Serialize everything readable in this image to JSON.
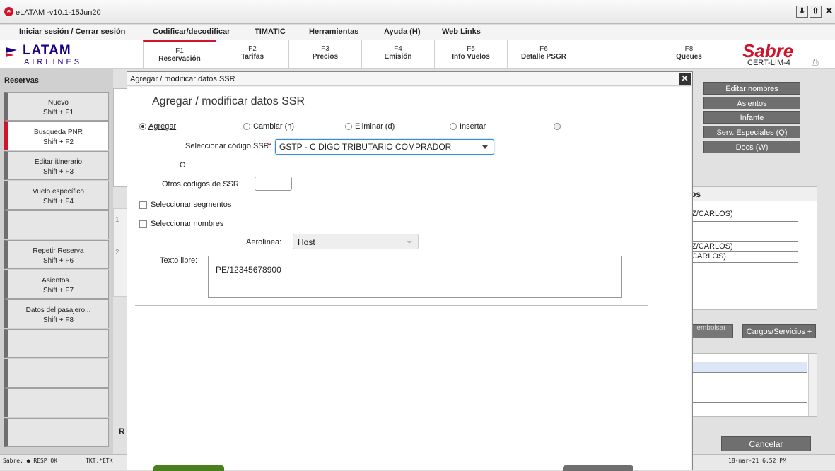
{
  "window": {
    "title": "eLATAM -v10.1-15Jun20",
    "buttons": [
      "⇩",
      "⇧",
      "✕"
    ]
  },
  "menu": [
    "Iniciar sesión / Cerrar sesión",
    "Codificar/decodificar",
    "TIMATIC",
    "Herramientas",
    "Ayuda (H)",
    "Web Links"
  ],
  "logo": {
    "brand": "LATAM",
    "sub": "AIRLINES"
  },
  "ftabs": [
    {
      "key": "F1",
      "label": "Reservación"
    },
    {
      "key": "F2",
      "label": "Tarifas"
    },
    {
      "key": "F3",
      "label": "Precios"
    },
    {
      "key": "F4",
      "label": "Emisión"
    },
    {
      "key": "F5",
      "label": "Info Vuelos"
    },
    {
      "key": "F6",
      "label": "Detalle PSGR"
    },
    {
      "key": "",
      "label": ""
    },
    {
      "key": "F8",
      "label": "Queues"
    }
  ],
  "sabre": {
    "brand": "Sabre",
    "env": "CERT-LIM-4"
  },
  "sidebar": {
    "header": "Reservas",
    "items": [
      {
        "title": "Nuevo",
        "key": "Shift + F1"
      },
      {
        "title": "Busqueda PNR",
        "key": "Shift + F2"
      },
      {
        "title": "Editar itinerario",
        "key": "Shift + F3"
      },
      {
        "title": "Vuelo específico",
        "key": "Shift + F4"
      },
      {
        "title": "",
        "key": ""
      },
      {
        "title": "Repetir Reserva",
        "key": "Shift + F6"
      },
      {
        "title": "Asientos...",
        "key": "Shift + F7"
      },
      {
        "title": "Datos del pasajero...",
        "key": "Shift + F8"
      },
      {
        "title": "",
        "key": ""
      },
      {
        "title": "",
        "key": ""
      },
      {
        "title": "",
        "key": ""
      },
      {
        "title": "",
        "key": ""
      }
    ]
  },
  "right_panel": {
    "buttons": [
      "Editar nombres",
      "Asientos",
      "Infante",
      "Serv. Especiales (Q)",
      "Docs (W)"
    ],
    "section_header": "os",
    "rows": [
      "Z/CARLOS)",
      "Z/CARLOS)",
      "CARLOS)"
    ],
    "bottom_buttons": [
      "embolsar",
      "Cargos/Servicios +"
    ],
    "cancel": "Cancelar"
  },
  "background_fragments": {
    "row_num_1": "1",
    "row_num_2": "2",
    "left_letter": "R"
  },
  "dialog": {
    "window_title": "Agregar / modificar datos SSR",
    "heading": "Agregar / modificar datos SSR",
    "radios": [
      {
        "label": "Agregar",
        "checked": true
      },
      {
        "label": "Cambiar (h)",
        "checked": false
      },
      {
        "label": "Eliminar (d)",
        "checked": false
      },
      {
        "label": "Insertar",
        "checked": false
      },
      {
        "label": "",
        "checked": false
      }
    ],
    "ssr_label": "Seleccionar código SSR:",
    "required_mark": "*",
    "ssr_value": "GSTP - C DIGO TRIBUTARIO COMPRADOR",
    "or_label": "O",
    "otros_label": "Otros códigos de SSR:",
    "otros_value": "",
    "seg_label": "Seleccionar segmentos",
    "names_label": "Seleccionar nombres",
    "airline_label": "Aerolínea:",
    "airline_value": "Host",
    "texto_label": "Texto libre:",
    "texto_value": "PE/12345678900"
  },
  "status": {
    "left": "Sabre: ● RESP OK",
    "tkt": "TKT:*ETK",
    "datetime": "18-mar-21 6:52 PM"
  }
}
